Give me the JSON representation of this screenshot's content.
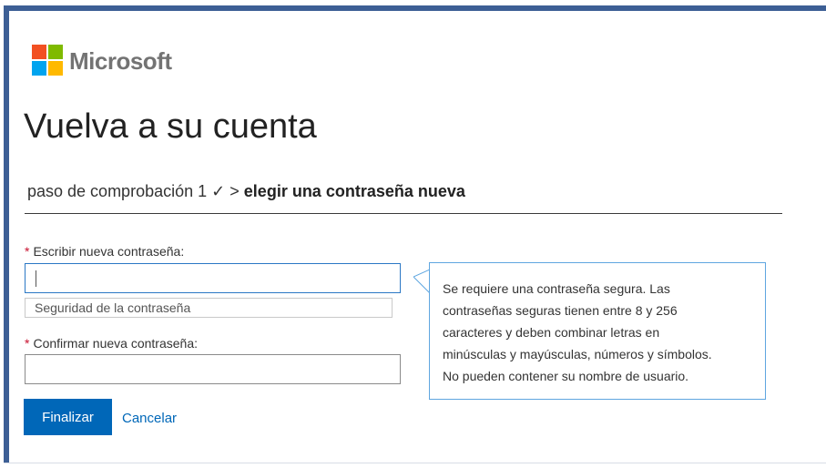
{
  "brand": {
    "name": "Microsoft",
    "logo_colors": [
      "#f25022",
      "#7fba00",
      "#00a4ef",
      "#ffb900"
    ]
  },
  "page": {
    "title": "Vuelva a su cuenta"
  },
  "steps": {
    "done": "paso de comprobación 1",
    "done_mark": "✓",
    "separator": ">",
    "current": "elegir una contraseña nueva"
  },
  "form": {
    "required_mark": "*",
    "new_password": {
      "label": "Escribir nueva contraseña:",
      "value": ""
    },
    "strength": {
      "label": "Seguridad de la contraseña"
    },
    "confirm_password": {
      "label": "Confirmar nueva contraseña:",
      "value": ""
    }
  },
  "tooltip": {
    "lines": [
      "Se requiere una contraseña segura. Las",
      "contraseñas seguras tienen entre 8 y 256",
      "caracteres y deben combinar letras en",
      "minúsculas y mayúsculas, números y símbolos.",
      "No pueden contener su nombre de usuario."
    ]
  },
  "actions": {
    "finish_label": "Finalizar",
    "cancel_label": "Cancelar"
  },
  "colors": {
    "accent": "#0067b8",
    "frame": "#3d5f95",
    "focus_border": "#2b78c5",
    "tooltip_border": "#5fa6e0",
    "required": "#c8102e"
  }
}
